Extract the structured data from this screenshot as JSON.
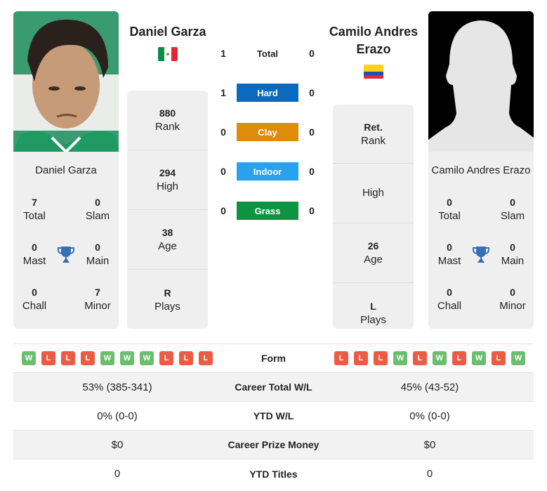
{
  "colors": {
    "hard": "#0a6abf",
    "clay": "#dd8c0b",
    "indoor": "#27a2f0",
    "grass": "#0e9440",
    "win": "#6cbe6f",
    "loss": "#ec5b43",
    "trophy": "#3a6fb7"
  },
  "player1": {
    "name": "Daniel Garza",
    "flag": "Mexico",
    "photo": "player-photo",
    "stats": [
      {
        "value": "880",
        "label": "Rank"
      },
      {
        "value": "294",
        "label": "High"
      },
      {
        "value": "38",
        "label": "Age"
      },
      {
        "value": "R",
        "label": "Plays"
      }
    ],
    "titles": {
      "total": {
        "value": "7",
        "label": "Total"
      },
      "slam": {
        "value": "0",
        "label": "Slam"
      },
      "mast": {
        "value": "0",
        "label": "Mast"
      },
      "main": {
        "value": "0",
        "label": "Main"
      },
      "chall": {
        "value": "0",
        "label": "Chall"
      },
      "minor": {
        "value": "7",
        "label": "Minor"
      }
    },
    "form": [
      "W",
      "L",
      "L",
      "L",
      "W",
      "W",
      "W",
      "L",
      "L",
      "L"
    ]
  },
  "player2": {
    "name": "Camilo Andres Erazo",
    "flag": "Colombia",
    "photo": "silhouette-placeholder",
    "stats": [
      {
        "value": "Ret.",
        "label": "Rank"
      },
      {
        "value": "",
        "label": "High"
      },
      {
        "value": "26",
        "label": "Age"
      },
      {
        "value": "L",
        "label": "Plays"
      }
    ],
    "titles": {
      "total": {
        "value": "0",
        "label": "Total"
      },
      "slam": {
        "value": "0",
        "label": "Slam"
      },
      "mast": {
        "value": "0",
        "label": "Mast"
      },
      "main": {
        "value": "0",
        "label": "Main"
      },
      "chall": {
        "value": "0",
        "label": "Chall"
      },
      "minor": {
        "value": "0",
        "label": "Minor"
      }
    },
    "form": [
      "L",
      "L",
      "L",
      "W",
      "L",
      "W",
      "L",
      "W",
      "L",
      "W"
    ]
  },
  "h2h": [
    {
      "label": "Total",
      "p1": "1",
      "p2": "0",
      "type": "total"
    },
    {
      "label": "Hard",
      "p1": "1",
      "p2": "0",
      "type": "hard"
    },
    {
      "label": "Clay",
      "p1": "0",
      "p2": "0",
      "type": "clay"
    },
    {
      "label": "Indoor",
      "p1": "0",
      "p2": "0",
      "type": "indoor"
    },
    {
      "label": "Grass",
      "p1": "0",
      "p2": "0",
      "type": "grass"
    }
  ],
  "comparison": [
    {
      "label": "Form",
      "p1": "",
      "p2": ""
    },
    {
      "label": "Career Total W/L",
      "p1": "53% (385-341)",
      "p2": "45% (43-52)"
    },
    {
      "label": "YTD W/L",
      "p1": "0% (0-0)",
      "p2": "0% (0-0)"
    },
    {
      "label": "Career Prize Money",
      "p1": "$0",
      "p2": "$0"
    },
    {
      "label": "YTD Titles",
      "p1": "0",
      "p2": "0"
    }
  ]
}
